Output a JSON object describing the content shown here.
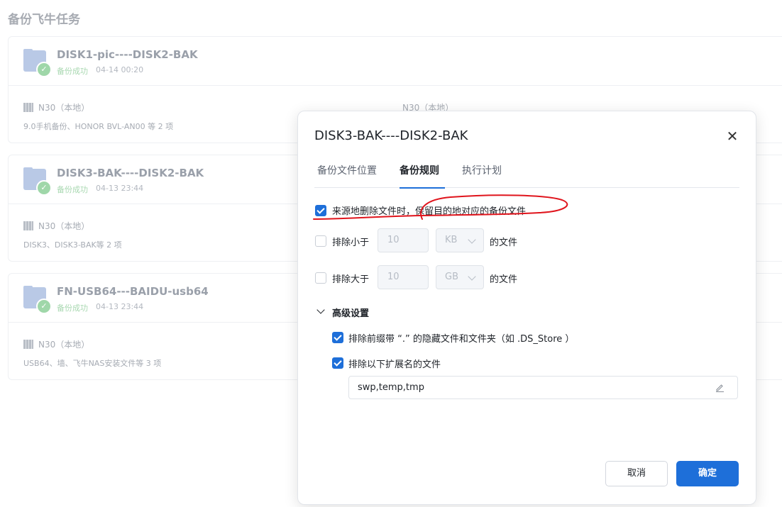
{
  "page": {
    "title": "备份飞牛任务"
  },
  "tasks": [
    {
      "name": "DISK1-pic----DISK2-BAK",
      "status": "备份成功",
      "time": "04-14 00:20",
      "source_device": "N30（本地）",
      "target_device": "N30（本地）",
      "desc": "9.0手机备份、HONOR BVL-AN00 等 2 项"
    },
    {
      "name": "DISK3-BAK----DISK2-BAK",
      "status": "备份成功",
      "time": "04-13 23:44",
      "source_device": "N30（本地）",
      "desc": "DISK3、DISK3-BAK等 2 项"
    },
    {
      "name": "FN-USB64---BAIDU-usb64",
      "status": "备份成功",
      "time": "04-13 23:44",
      "source_device": "N30（本地）",
      "desc": "USB64、墙、飞牛NAS安装文件等 3 项"
    }
  ],
  "modal": {
    "title": "DISK3-BAK----DISK2-BAK",
    "tabs": [
      "备份文件位置",
      "备份规则",
      "执行计划"
    ],
    "active_tab": "备份规则",
    "rules": {
      "keep_on_delete": {
        "checked": true,
        "label_a": "来源地删除文件时，",
        "label_b": "保留目的地对应的备份文件"
      },
      "exclude_smaller": {
        "checked": false,
        "prefix": "排除小于",
        "value": "10",
        "unit": "KB",
        "suffix": "的文件"
      },
      "exclude_larger": {
        "checked": false,
        "prefix": "排除大于",
        "value": "10",
        "unit": "GB",
        "suffix": "的文件"
      }
    },
    "advanced": {
      "title": "高级设置",
      "expanded": true,
      "exclude_hidden": {
        "checked": true,
        "label": "排除前缀带 “.” 的隐藏文件和文件夹（如 .DS_Store ）"
      },
      "exclude_ext": {
        "checked": true,
        "label": "排除以下扩展名的文件",
        "value": "swp,temp,tmp"
      }
    },
    "buttons": {
      "cancel": "取消",
      "ok": "确定"
    }
  },
  "colors": {
    "accent": "#1e6fd9",
    "annotation": "#e0141c",
    "success": "#9fd7a9"
  }
}
